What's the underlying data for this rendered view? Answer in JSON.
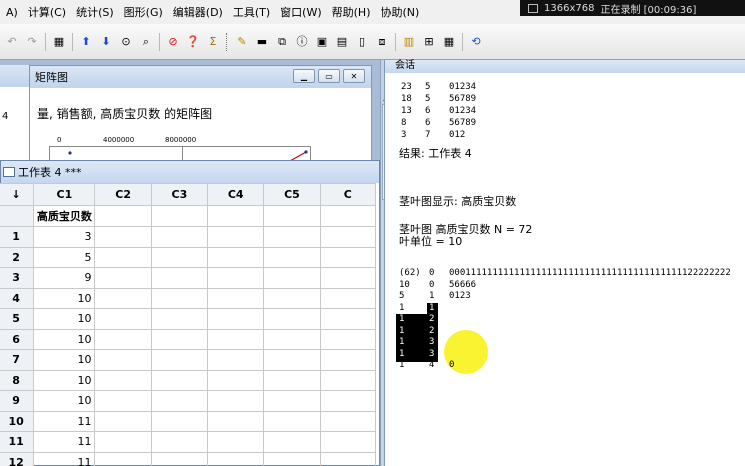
{
  "menu": [
    "A)",
    "计算(C)",
    "统计(S)",
    "图形(G)",
    "编辑器(D)",
    "工具(T)",
    "窗口(W)",
    "帮助(H)",
    "协助(N)"
  ],
  "recorder": {
    "resolution": "1366x768",
    "status": "正在录制 [00:09:36]"
  },
  "toolbar": [
    "undo-icon",
    "redo-icon",
    "sep",
    "worksheet-icon",
    "sep",
    "arrow-up-icon",
    "arrow-down-icon",
    "binoculars-icon",
    "find-icon",
    "sep",
    "cancel-icon",
    "help-icon",
    "sigma-icon",
    "grip",
    "graph-edit-icon",
    "brush-icon",
    "link-icon",
    "info-icon",
    "assistant-icon",
    "worksheet-new-icon",
    "document-icon",
    "copy-icon",
    "sep",
    "session-icon",
    "grid-icon",
    "table-icon",
    "sep",
    "history-icon"
  ],
  "plot_window": {
    "title": "矩阵图",
    "heading": "量, 销售额, 高质宝贝数 的矩阵图",
    "ticks": [
      "0",
      "4000000",
      "8000000"
    ]
  },
  "left_fragment": {
    "value": "4"
  },
  "worksheet": {
    "title": "工作表 4 ***",
    "columns": [
      "C1",
      "C2",
      "C3",
      "C4",
      "C5",
      "C"
    ],
    "column_names": [
      "高质宝贝数",
      "",
      "",
      "",
      "",
      ""
    ],
    "rows": [
      {
        "n": "1",
        "c1": "3"
      },
      {
        "n": "2",
        "c1": "5"
      },
      {
        "n": "3",
        "c1": "9"
      },
      {
        "n": "4",
        "c1": "10"
      },
      {
        "n": "5",
        "c1": "10"
      },
      {
        "n": "6",
        "c1": "10"
      },
      {
        "n": "7",
        "c1": "10"
      },
      {
        "n": "8",
        "c1": "10"
      },
      {
        "n": "9",
        "c1": "10"
      },
      {
        "n": "10",
        "c1": "11"
      },
      {
        "n": "11",
        "c1": "11"
      },
      {
        "n": "12",
        "c1": "11"
      }
    ]
  },
  "session": {
    "title": "会话",
    "prev_rows": [
      [
        "23",
        "5",
        "01234"
      ],
      [
        "18",
        "5",
        "56789"
      ],
      [
        "13",
        "6",
        "01234"
      ],
      [
        "8",
        "6",
        "56789"
      ],
      [
        "3",
        "7",
        "012"
      ]
    ],
    "result_title": "结果: 工作表 4",
    "stem_title": "茎叶图显示: 高质宝贝数",
    "stem_line1": "茎叶图 高质宝贝数  N  = 72",
    "stem_line2": "叶单位 = 10",
    "stem_rows": [
      [
        "(62)",
        "0",
        "0001111111111111111111111111111111111111111122222222"
      ],
      [
        "10",
        "0",
        "56666"
      ],
      [
        "5",
        "1",
        "0123"
      ],
      [
        "1",
        "1",
        ""
      ],
      [
        "1",
        "2",
        ""
      ],
      [
        "1",
        "2",
        ""
      ],
      [
        "1",
        "3",
        ""
      ],
      [
        "1",
        "3",
        ""
      ],
      [
        "1",
        "4",
        "0"
      ]
    ]
  }
}
